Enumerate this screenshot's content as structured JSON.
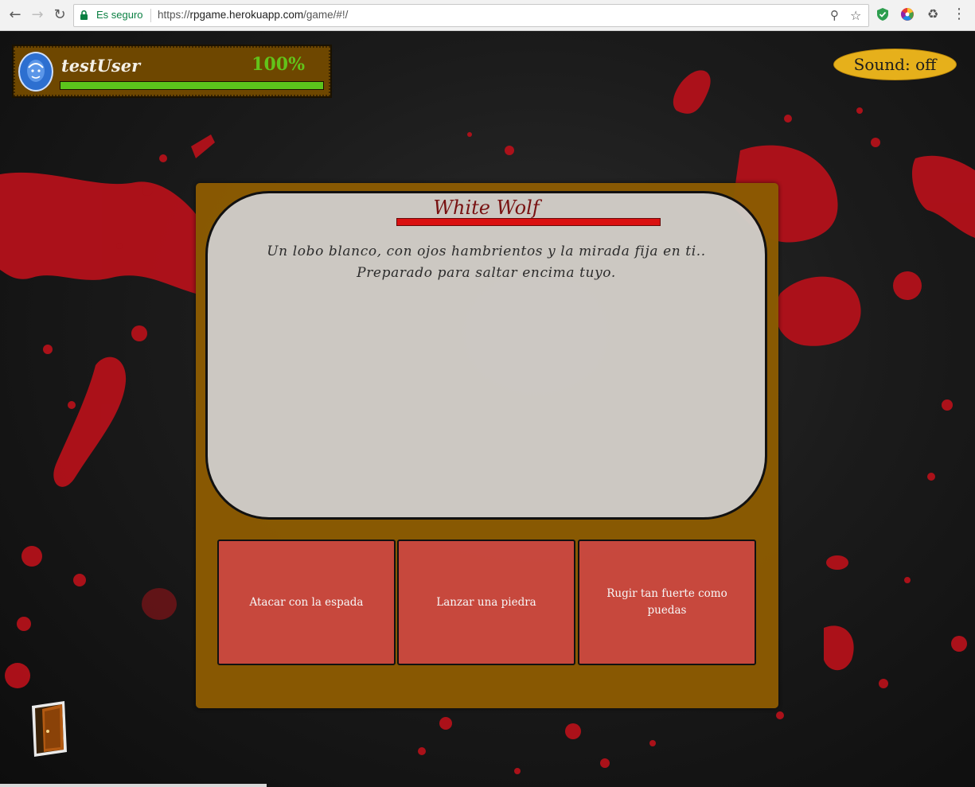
{
  "browser": {
    "secure_label": "Es seguro",
    "url_scheme": "https://",
    "url_host": "rpgame.herokuapp.com",
    "url_path": "/game/#!/",
    "back_icon": "arrow-left-icon",
    "forward_icon": "arrow-right-icon",
    "reload_icon": "reload-icon"
  },
  "hud": {
    "player_name": "testUser",
    "health_text": "100%",
    "health_fraction": 1.0,
    "sound_label": "Sound: off"
  },
  "enemy": {
    "name": "White Wolf",
    "description": "Un lobo blanco, con ojos hambrientos y la mirada fija en ti.. Preparado para saltar encima tuyo.",
    "health_fraction": 1.0
  },
  "actions": [
    {
      "label": "Atacar con la espada"
    },
    {
      "label": "Lanzar una piedra"
    },
    {
      "label": "Rugir tan fuerte como puedas"
    }
  ],
  "colors": {
    "panel": "#8c5b02",
    "hud": "#6e4700",
    "health_green": "#5bc41c",
    "enemy_hp": "#e01010",
    "blood": "#c0121b",
    "sound_button": "#e6b01b",
    "action_button": "#d64848"
  }
}
